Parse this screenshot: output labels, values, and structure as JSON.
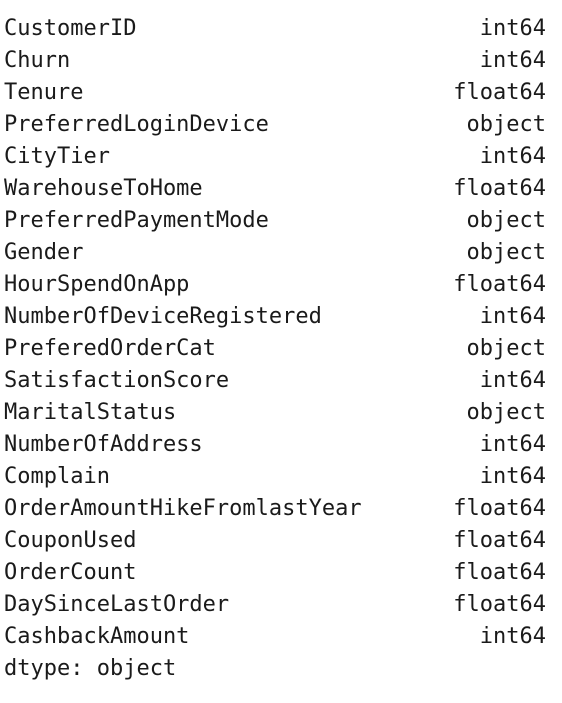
{
  "series": [
    {
      "name": "CustomerID",
      "dtype": "int64"
    },
    {
      "name": "Churn",
      "dtype": "int64"
    },
    {
      "name": "Tenure",
      "dtype": "float64"
    },
    {
      "name": "PreferredLoginDevice",
      "dtype": "object"
    },
    {
      "name": "CityTier",
      "dtype": "int64"
    },
    {
      "name": "WarehouseToHome",
      "dtype": "float64"
    },
    {
      "name": "PreferredPaymentMode",
      "dtype": "object"
    },
    {
      "name": "Gender",
      "dtype": "object"
    },
    {
      "name": "HourSpendOnApp",
      "dtype": "float64"
    },
    {
      "name": "NumberOfDeviceRegistered",
      "dtype": "int64"
    },
    {
      "name": "PreferedOrderCat",
      "dtype": "object"
    },
    {
      "name": "SatisfactionScore",
      "dtype": "int64"
    },
    {
      "name": "MaritalStatus",
      "dtype": "object"
    },
    {
      "name": "NumberOfAddress",
      "dtype": "int64"
    },
    {
      "name": "Complain",
      "dtype": "int64"
    },
    {
      "name": "OrderAmountHikeFromlastYear",
      "dtype": "float64"
    },
    {
      "name": "CouponUsed",
      "dtype": "float64"
    },
    {
      "name": "OrderCount",
      "dtype": "float64"
    },
    {
      "name": "DaySinceLastOrder",
      "dtype": "float64"
    },
    {
      "name": "CashbackAmount",
      "dtype": "int64"
    }
  ],
  "footer": "dtype: object"
}
